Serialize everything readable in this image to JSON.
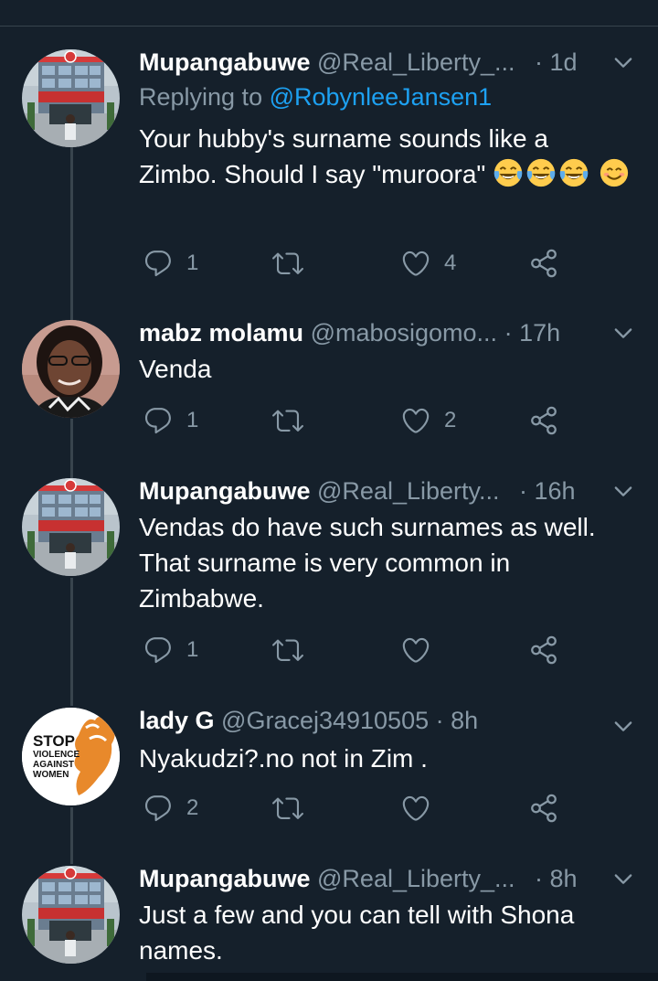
{
  "tweets": [
    {
      "name": "Mupangabuwe",
      "handle": "@Real_Liberty_...",
      "time": "· 1d",
      "replying_prefix": "Replying to",
      "replying_to": "@RobynleeJansen1",
      "body": "Your hubby's surname sounds like a Zimbo. Should I say \"muroora\"",
      "reply_count": "1",
      "retweet_count": "",
      "like_count": "4"
    },
    {
      "name": "mabz molamu",
      "handle": "@mabosigomo...",
      "time": "· 17h",
      "body": "Venda",
      "reply_count": "1",
      "retweet_count": "",
      "like_count": "2"
    },
    {
      "name": "Mupangabuwe",
      "handle": "@Real_Liberty...",
      "time": "· 16h",
      "body": "Vendas do have such surnames as well. That surname is very common in Zimbabwe.",
      "reply_count": "1",
      "retweet_count": "",
      "like_count": ""
    },
    {
      "name": "lady G",
      "handle": "@Gracej34910505",
      "time": "· 8h",
      "body": "Nyakudzi?.no not in Zim .",
      "reply_count": "2",
      "retweet_count": "",
      "like_count": "",
      "avatar_text": [
        "STOP",
        "VIOLENCE",
        "AGAINST",
        "WOMEN"
      ]
    },
    {
      "name": "Mupangabuwe",
      "handle": "@Real_Liberty_...",
      "time": "· 8h",
      "body": "Just a few and you can tell with Shona names."
    }
  ],
  "colors": {
    "background": "#15202b",
    "secondary_text": "#8899a6",
    "link": "#1da1f2",
    "divider": "#38444d"
  },
  "icons": [
    "reply-icon",
    "retweet-icon",
    "like-icon",
    "share-icon",
    "chevron-down-icon",
    "laughing-emoji-icon",
    "smiling-emoji-icon"
  ]
}
